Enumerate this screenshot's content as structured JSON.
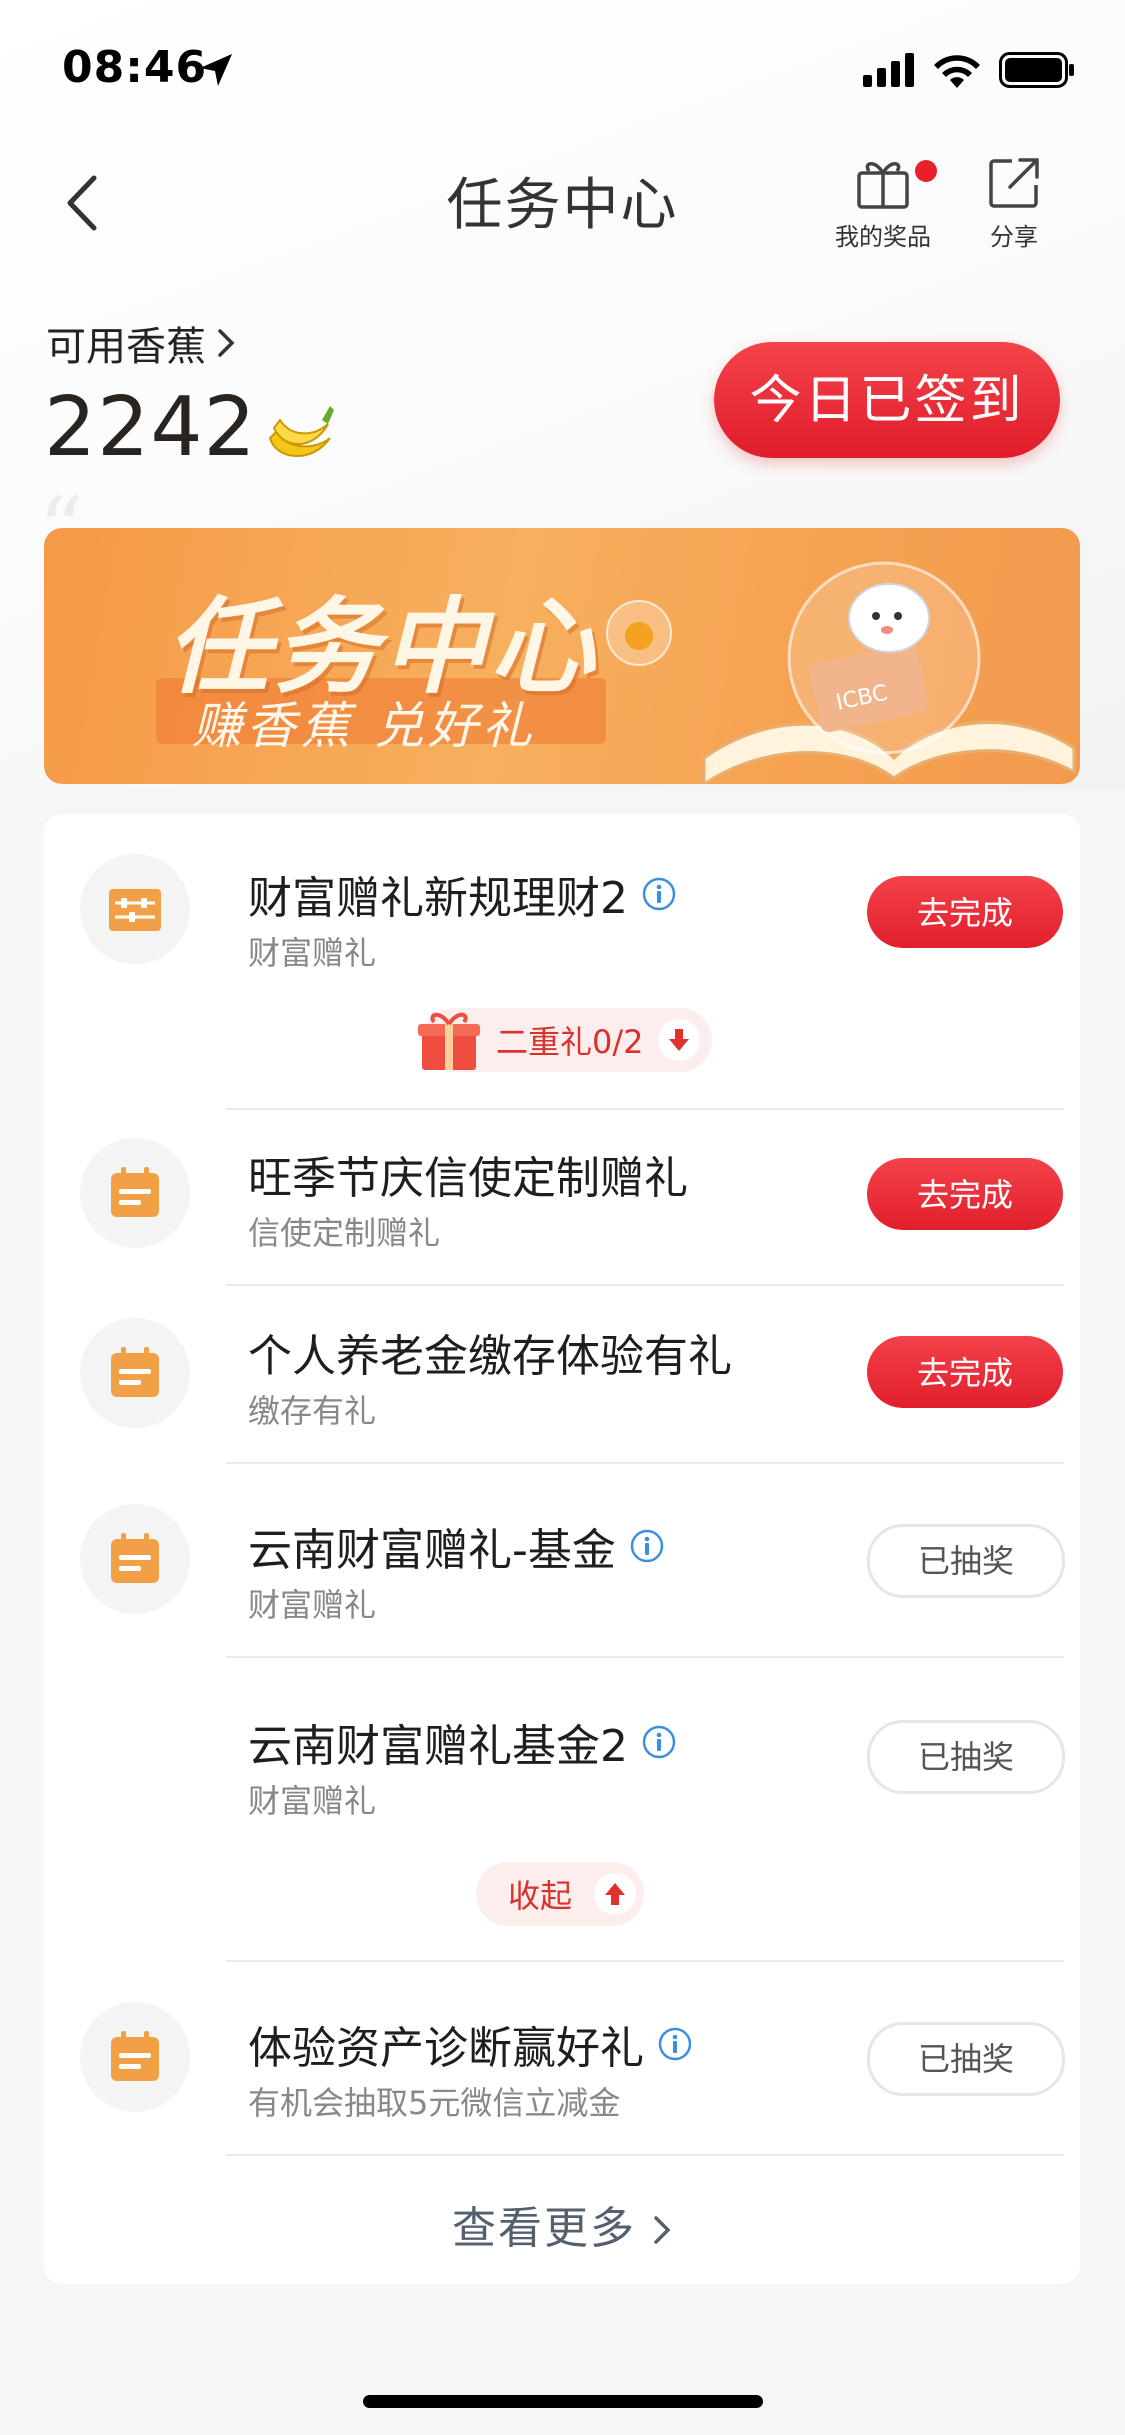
{
  "status_bar": {
    "time": "08:46"
  },
  "header": {
    "title": "任务中心",
    "my_prizes_label": "我的奖品",
    "share_label": "分享"
  },
  "balance": {
    "label": "可用香蕉",
    "value": "2242"
  },
  "signin_button": "今日已签到",
  "banner": {
    "title": "任务中心",
    "subtitle": "赚香蕉 兑好礼",
    "logo_text": "ICBC"
  },
  "tasks": [
    {
      "title": "财富赠礼新规理财2",
      "subtitle": "财富赠礼",
      "action": "去完成",
      "icon": "abacus-icon",
      "has_info": true
    },
    {
      "title": "旺季节庆信使定制赠礼",
      "subtitle": "信使定制赠礼",
      "action": "去完成",
      "icon": "calendar-icon",
      "has_info": false
    },
    {
      "title": "个人养老金缴存体验有礼",
      "subtitle": "缴存有礼",
      "action": "去完成",
      "icon": "calendar-icon",
      "has_info": false
    },
    {
      "title": "云南财富赠礼-基金",
      "subtitle": "财富赠礼",
      "action": "已抽奖",
      "icon": "calendar-icon",
      "has_info": true
    },
    {
      "title": "云南财富赠礼基金2",
      "subtitle": "财富赠礼",
      "action": "已抽奖",
      "icon": "",
      "has_info": true
    },
    {
      "title": "体验资产诊断赢好礼",
      "subtitle": "有机会抽取5元微信立减金",
      "action": "已抽奖",
      "icon": "calendar-icon",
      "has_info": true
    }
  ],
  "second_gift_tag": "二重礼0/2",
  "collapse_label": "收起",
  "view_more": "查看更多",
  "colors": {
    "primary_red": "#e41f2b",
    "accent_orange": "#f2a046"
  }
}
